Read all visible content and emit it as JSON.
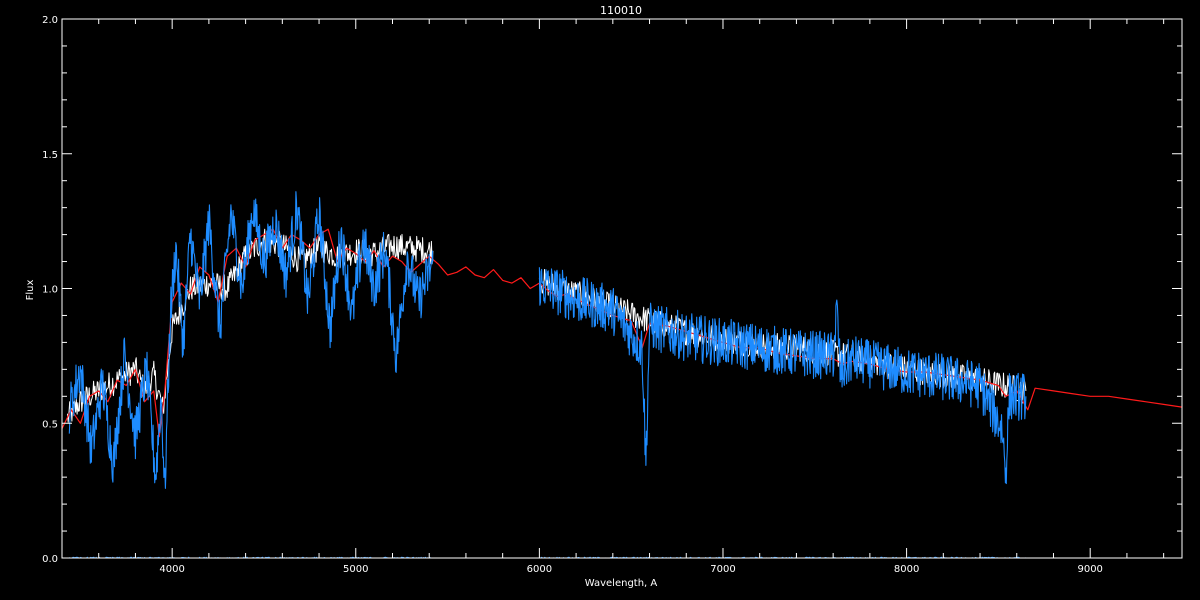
{
  "chart_data": {
    "type": "line",
    "title": "110010",
    "xlabel": "Wavelength, A",
    "ylabel": "Flux",
    "xlim": [
      3400,
      9500
    ],
    "ylim": [
      0.0,
      2.0
    ],
    "x_ticks": [
      4000,
      5000,
      6000,
      7000,
      8000,
      9000
    ],
    "x_tick_labels": [
      "4000",
      "5000",
      "6000",
      "7000",
      "8000",
      "9000"
    ],
    "y_ticks": [
      0.0,
      0.5,
      1.0,
      1.5,
      2.0
    ],
    "y_tick_labels": [
      "0.0",
      "0.5",
      "1.0",
      "1.5",
      "2.0"
    ],
    "grid": false,
    "colors": {
      "background": "#000000",
      "axes": "#ffffff",
      "observed": "#ffffff",
      "model": "#ff1a1a",
      "fit": "#1e8cff",
      "error": "#1e8cff"
    },
    "series": [
      {
        "role": "observed",
        "segments": [
          {
            "x": [
              3430,
              3500,
              3600,
              3700,
              3800,
              3850,
              3900,
              3950,
              4000,
              4100,
              4200,
              4300,
              4400,
              4500,
              4600,
              4700,
              4800,
              4900,
              5000,
              5100,
              5200,
              5300,
              5420
            ],
            "y": [
              0.52,
              0.58,
              0.62,
              0.66,
              0.7,
              0.62,
              0.68,
              0.55,
              0.85,
              1.0,
              1.02,
              1.0,
              1.12,
              1.18,
              1.16,
              1.1,
              1.15,
              1.12,
              1.14,
              1.13,
              1.16,
              1.15,
              1.14
            ]
          },
          {
            "x": [
              6000,
              6200,
              6400,
              6600,
              6800,
              7000,
              7200,
              7400,
              7600,
              7800,
              8000,
              8200,
              8400,
              8650
            ],
            "y": [
              1.03,
              0.98,
              0.93,
              0.88,
              0.84,
              0.81,
              0.79,
              0.78,
              0.76,
              0.73,
              0.7,
              0.68,
              0.66,
              0.62
            ]
          }
        ]
      },
      {
        "role": "model",
        "segments": [
          {
            "x": [
              3400,
              3450,
              3500,
              3550,
              3600,
              3650,
              3700,
              3750,
              3800,
              3850,
              3900,
              3930,
              3960,
              4000,
              4050,
              4100,
              4150,
              4200,
              4250,
              4300,
              4350,
              4400,
              4450,
              4500,
              4550,
              4600,
              4650,
              4700,
              4750,
              4800,
              4850,
              4900,
              4950,
              5000,
              5050,
              5100,
              5150,
              5200,
              5250,
              5300,
              5350,
              5400,
              5450,
              5500,
              5550,
              5600,
              5650,
              5700,
              5750,
              5800,
              5850,
              5900,
              5950,
              6000,
              6050,
              6100,
              6150,
              6200,
              6300,
              6400,
              6500,
              6560,
              6600,
              6700,
              6800,
              6900,
              7000,
              7100,
              7200,
              7300,
              7400,
              7500,
              7600,
              7650,
              7700,
              7800,
              7900,
              8000,
              8100,
              8200,
              8300,
              8400,
              8500,
              8540,
              8600,
              8660,
              8700,
              8800,
              8900,
              9000,
              9100,
              9200,
              9300,
              9400,
              9500
            ],
            "y": [
              0.48,
              0.55,
              0.5,
              0.6,
              0.62,
              0.58,
              0.66,
              0.64,
              0.7,
              0.58,
              0.62,
              0.45,
              0.62,
              0.95,
              1.02,
              0.98,
              1.08,
              1.05,
              0.95,
              1.12,
              1.15,
              1.08,
              1.18,
              1.2,
              1.22,
              1.15,
              1.2,
              1.18,
              1.15,
              1.2,
              1.22,
              1.1,
              1.15,
              1.13,
              1.1,
              1.14,
              1.08,
              1.12,
              1.1,
              1.06,
              1.09,
              1.12,
              1.09,
              1.05,
              1.06,
              1.08,
              1.05,
              1.04,
              1.07,
              1.03,
              1.02,
              1.04,
              1.0,
              1.02,
              0.99,
              0.97,
              0.98,
              0.96,
              0.93,
              0.9,
              0.88,
              0.78,
              0.87,
              0.86,
              0.84,
              0.82,
              0.8,
              0.78,
              0.78,
              0.76,
              0.75,
              0.74,
              0.74,
              0.72,
              0.73,
              0.72,
              0.7,
              0.69,
              0.69,
              0.68,
              0.67,
              0.66,
              0.64,
              0.6,
              0.62,
              0.55,
              0.63,
              0.62,
              0.61,
              0.6,
              0.6,
              0.59,
              0.58,
              0.57,
              0.56
            ]
          }
        ]
      },
      {
        "role": "fit",
        "segments": [
          {
            "x": [
              3440,
              3500,
              3560,
              3620,
              3680,
              3740,
              3800,
              3860,
              3910,
              3940,
              3960,
              3990,
              4020,
              4060,
              4100,
              4150,
              4200,
              4260,
              4320,
              4380,
              4440,
              4500,
              4560,
              4620,
              4680,
              4740,
              4800,
              4860,
              4920,
              4980,
              5040,
              5100,
              5160,
              5220,
              5280,
              5340,
              5420
            ],
            "y": [
              0.55,
              0.7,
              0.4,
              0.65,
              0.35,
              0.75,
              0.45,
              0.7,
              0.3,
              0.6,
              0.25,
              0.9,
              1.15,
              0.8,
              1.2,
              0.95,
              1.25,
              0.85,
              1.28,
              1.0,
              1.3,
              1.1,
              1.25,
              1.05,
              1.3,
              0.95,
              1.28,
              0.85,
              1.2,
              0.9,
              1.18,
              1.0,
              1.15,
              0.75,
              1.12,
              0.95,
              1.1
            ]
          },
          {
            "x": [
              6000,
              6200,
              6400,
              6560,
              6580,
              6600,
              6800,
              7000,
              7200,
              7400,
              7600,
              7620,
              7640,
              7700,
              7800,
              8000,
              8200,
              8400,
              8520,
              8540,
              8560,
              8650
            ],
            "y": [
              1.02,
              0.96,
              0.92,
              0.78,
              0.35,
              0.86,
              0.82,
              0.8,
              0.78,
              0.76,
              0.75,
              0.92,
              0.68,
              0.74,
              0.72,
              0.69,
              0.67,
              0.64,
              0.48,
              0.32,
              0.6,
              0.6
            ]
          }
        ]
      },
      {
        "role": "error",
        "segments": [
          {
            "x": [
              3430,
              5420
            ],
            "y": [
              0.0,
              0.0
            ]
          },
          {
            "x": [
              6000,
              8650
            ],
            "y": [
              0.0,
              0.0
            ]
          }
        ]
      }
    ]
  }
}
